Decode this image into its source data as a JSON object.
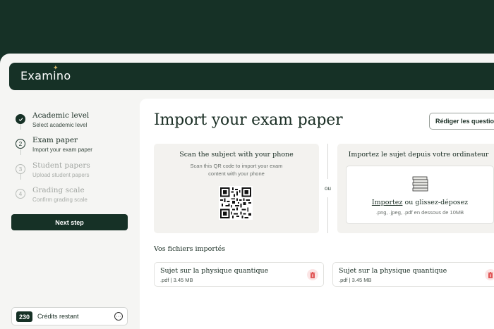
{
  "app": {
    "logo": "Examino"
  },
  "steps": [
    {
      "number": "✓",
      "title": "Academic level",
      "subtitle": "Select academic level",
      "state": "done"
    },
    {
      "number": "2",
      "title": "Exam paper",
      "subtitle": "Import your exam paper",
      "state": "active"
    },
    {
      "number": "3",
      "title": "Student papers",
      "subtitle": "Upload student papers",
      "state": "pending"
    },
    {
      "number": "4",
      "title": "Grading scale",
      "subtitle": "Confirm grading scale",
      "state": "pending"
    }
  ],
  "sidebar": {
    "next_label": "Next step",
    "credits_count": "230",
    "credits_label": "Crédits restant",
    "more_glyph": "···"
  },
  "main": {
    "title": "Import your exam paper",
    "write_button": "Rédiger les questions"
  },
  "scan": {
    "title": "Scan the subject with your phone",
    "description": "Scan this QR code to import your exam content with your phone"
  },
  "separator": "ou",
  "upload": {
    "title": "Importez le sujet depuis votre ordinateur",
    "link": "Importez",
    "rest": " ou glissez-déposez",
    "formats": ".png, .jpeg, .pdf en dessous de 10MB"
  },
  "files": {
    "title": "Vos fichiers importés",
    "items": [
      {
        "name": "Sujet sur la physique quantique",
        "meta": ".pdf | 3.45 MB"
      },
      {
        "name": "Sujet sur la physique quantique",
        "meta": ".pdf | 3.45 MB"
      }
    ]
  },
  "colors": {
    "brand_dark": "#163126",
    "accent_gold": "#d9b96a",
    "delete_red": "#e05555"
  },
  "icons": {
    "step_done": "check-icon",
    "delete": "trash-icon",
    "qr": "qr-code-icon",
    "docs": "document-stack-icon",
    "more": "more-horizontal-icon"
  }
}
